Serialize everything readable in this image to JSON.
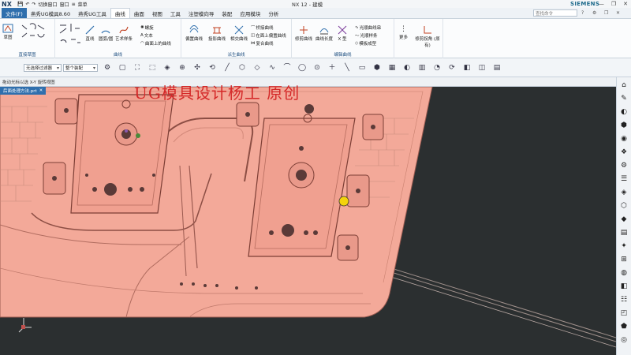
{
  "titlebar": {
    "logo": "NX",
    "quick_access": {
      "save": "💾",
      "undo": "↶",
      "redo": "↷",
      "switch_window": "切换窗口",
      "window": "窗口",
      "menu_icon": "≡",
      "more": "菜单"
    },
    "app_title": "NX 12 - 建模",
    "brand": "SIEMENS",
    "window_controls": {
      "minimize": "—",
      "restore": "❐",
      "close": "✕"
    }
  },
  "menu": {
    "tabs": [
      "文件(F)",
      "燕秀UG模具8.60",
      "燕秀UG工具",
      "曲线",
      "曲面",
      "视图",
      "工具",
      "注塑模向导",
      "装配",
      "应用模块",
      "分析"
    ],
    "active_tab": "曲线",
    "search_placeholder": "查找命令"
  },
  "ribbon": {
    "groups": [
      {
        "label": "直接草图",
        "items": [
          "草图"
        ]
      },
      {
        "label": "曲线",
        "items": [
          "直线",
          "圆弧/圆",
          "艺术样条",
          "螺旋",
          "文本",
          "曲面上的曲线"
        ]
      },
      {
        "label": "派生曲线",
        "items": [
          "偏置曲线",
          "投影曲线",
          "相交曲线",
          "桥接曲线",
          "在面上偏置曲线",
          "复合曲线"
        ]
      },
      {
        "label": "编辑曲线",
        "items": [
          "修剪曲线",
          "曲线长度",
          "X 型",
          "光顺样条",
          "模板成型",
          "光顺曲线串"
        ]
      },
      {
        "label": "",
        "items": [
          "更多",
          "修剪拐角 (原有)"
        ]
      }
    ]
  },
  "toolbar": {
    "filter": "无选择过滤器",
    "scope": "整个装配",
    "icons": [
      "⚙",
      "▢",
      "⛶",
      "⬚",
      "◈",
      "⊕",
      "✣",
      "⟲",
      "╱",
      "⬡",
      "◇",
      "∿",
      "⌒",
      "◯",
      "⊙",
      "＋",
      "╲",
      "▭",
      "⬢",
      "▦",
      "◐",
      "▥",
      "◔",
      "⟳",
      "◧",
      "◫",
      "▤"
    ]
  },
  "navstrip": {
    "hint": "拖动光标以选 X-Y 旋转视图"
  },
  "document_tab": {
    "label": "后面处理方法.prt",
    "close": "✕"
  },
  "watermark": "UG模具设计杨工 原创",
  "sidebar_icons": [
    "⌂",
    "✎",
    "◐",
    "⬢",
    "◉",
    "❖",
    "⚙",
    "☰",
    "◈",
    "⬡",
    "◆",
    "▤",
    "✦",
    "⊞",
    "◍",
    "◧",
    "☷",
    "◰",
    "⬟",
    "◎"
  ],
  "colors": {
    "accent": "#2f6fad",
    "part": "#f3a999",
    "part_edge": "#9b5a50",
    "background": "#2b2f30"
  }
}
